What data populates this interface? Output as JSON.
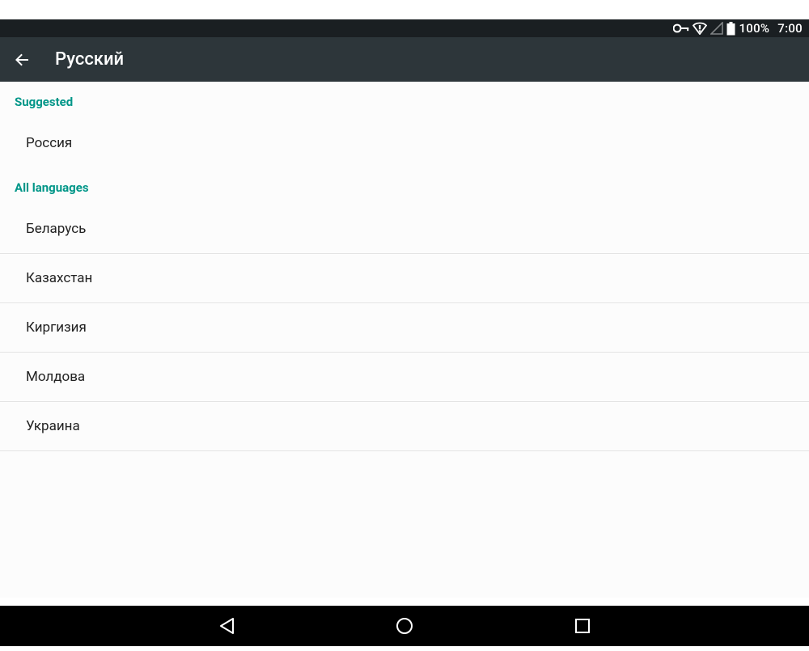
{
  "status_bar": {
    "battery_text": "100%",
    "clock": "7:00"
  },
  "app_bar": {
    "title": "Русский"
  },
  "sections": {
    "suggested_header": "Suggested",
    "all_header": "All languages"
  },
  "suggested_items": [
    {
      "label": "Россия"
    }
  ],
  "all_items": [
    {
      "label": "Беларусь"
    },
    {
      "label": "Казахстан"
    },
    {
      "label": "Киргизия"
    },
    {
      "label": "Молдова"
    },
    {
      "label": "Украина"
    }
  ]
}
